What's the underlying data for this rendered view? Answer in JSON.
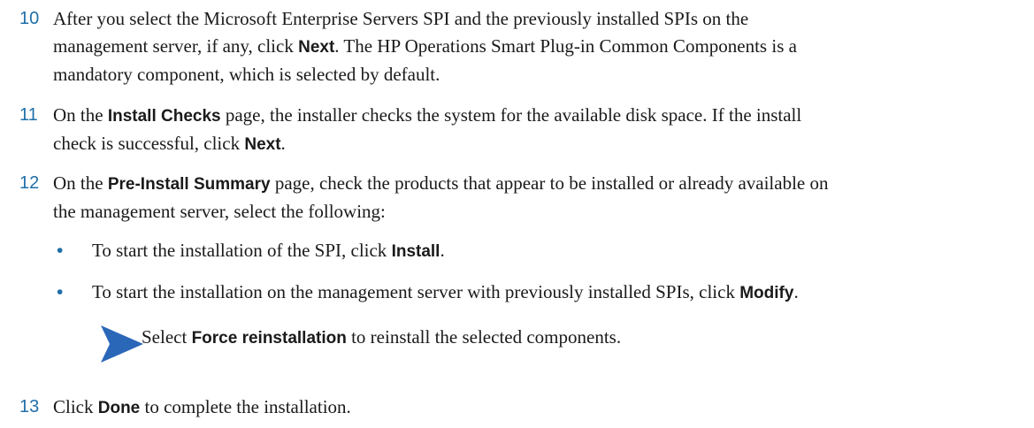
{
  "steps": [
    {
      "number": "10",
      "lines": [
        "After you select the Microsoft Enterprise Servers SPI and the previously installed SPIs on the",
        "management server, if any, click ",
        "Next",
        ". The HP Operations Smart Plug-in Common Components is a",
        "mandatory component, which is selected by default."
      ]
    },
    {
      "number": "11",
      "pre": "On the ",
      "bold": "Install Checks",
      "line1_rest": " page, the installer checks the system for the available disk space. If the install",
      "line2_pre": "check is successful, click ",
      "line2_bold": "Next",
      "line2_post": "."
    },
    {
      "number": "12",
      "pre": "On the ",
      "bold": "Pre-Install Summary",
      "line1_rest": " page, check the products that appear to be installed or already available on",
      "line2": "the management server, select the following:"
    },
    {
      "number": "13",
      "pre": "Click ",
      "bold": "Done",
      "post": " to complete the installation."
    }
  ],
  "bullets": [
    {
      "symbol": "•",
      "pre": "To start the installation of the SPI, click ",
      "bold": "Install",
      "post": "."
    },
    {
      "symbol": "•",
      "pre": "To start the installation on the management server with previously installed SPIs, click ",
      "bold": "Modify",
      "post": "."
    }
  ],
  "note": {
    "pre": "Select ",
    "bold": "Force reinstallation",
    "post": " to reinstall the selected components."
  },
  "colors": {
    "accent": "#1f6fa8",
    "arrow": "#2b67b8",
    "text": "#1a1a1a"
  }
}
